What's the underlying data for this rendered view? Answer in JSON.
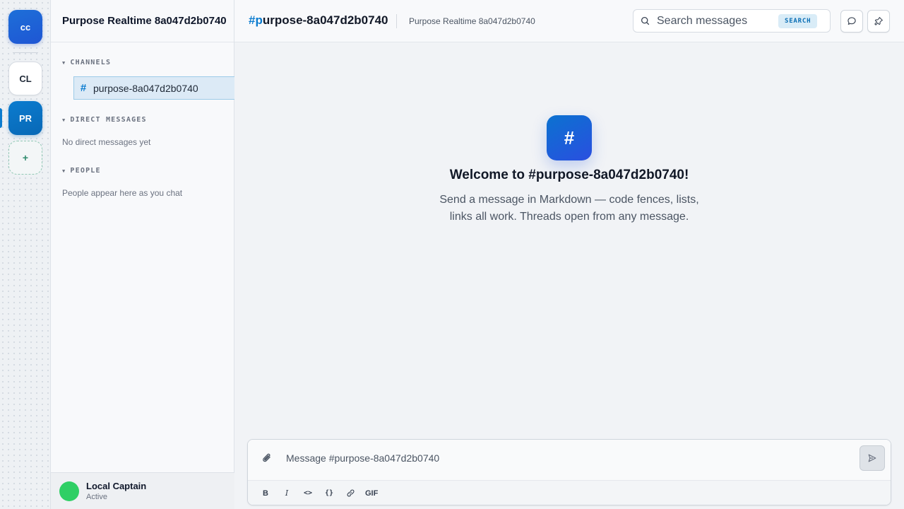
{
  "rail": {
    "workspaces": [
      {
        "label": "cc"
      },
      {
        "label": "CL"
      },
      {
        "label": "PR"
      },
      {
        "label": "+"
      }
    ]
  },
  "sidebar": {
    "title": "Purpose Realtime 8a047d2b0740",
    "channels_header": "CHANNELS",
    "channels": [
      {
        "hash": "#",
        "name": "purpose-8a047d2b0740"
      }
    ],
    "dm_header": "DIRECT MESSAGES",
    "dm_empty": "No direct messages yet",
    "people_header": "PEOPLE",
    "people_empty": "People appear here as you chat",
    "user": {
      "name": "Local Captain",
      "status": "Active"
    }
  },
  "header": {
    "title_accent": "#p",
    "title_rest": "urpose-8a047d2b0740",
    "subtitle": "Purpose Realtime 8a047d2b0740",
    "search_placeholder": "Search messages",
    "search_button": "SEARCH"
  },
  "welcome": {
    "icon": "#",
    "title": "Welcome to #purpose-8a047d2b0740!",
    "text": "Send a message in Markdown — code fences, lists, links all work. Threads open from any message."
  },
  "composer": {
    "placeholder": "Message #purpose-8a047d2b0740",
    "toolbar": {
      "bold": "B",
      "italic": "I",
      "code": "<>",
      "codeblock": "{}",
      "gif": "GIF"
    }
  },
  "colors": {
    "accent": "#0b7ccf",
    "online": "#2fcf65"
  }
}
